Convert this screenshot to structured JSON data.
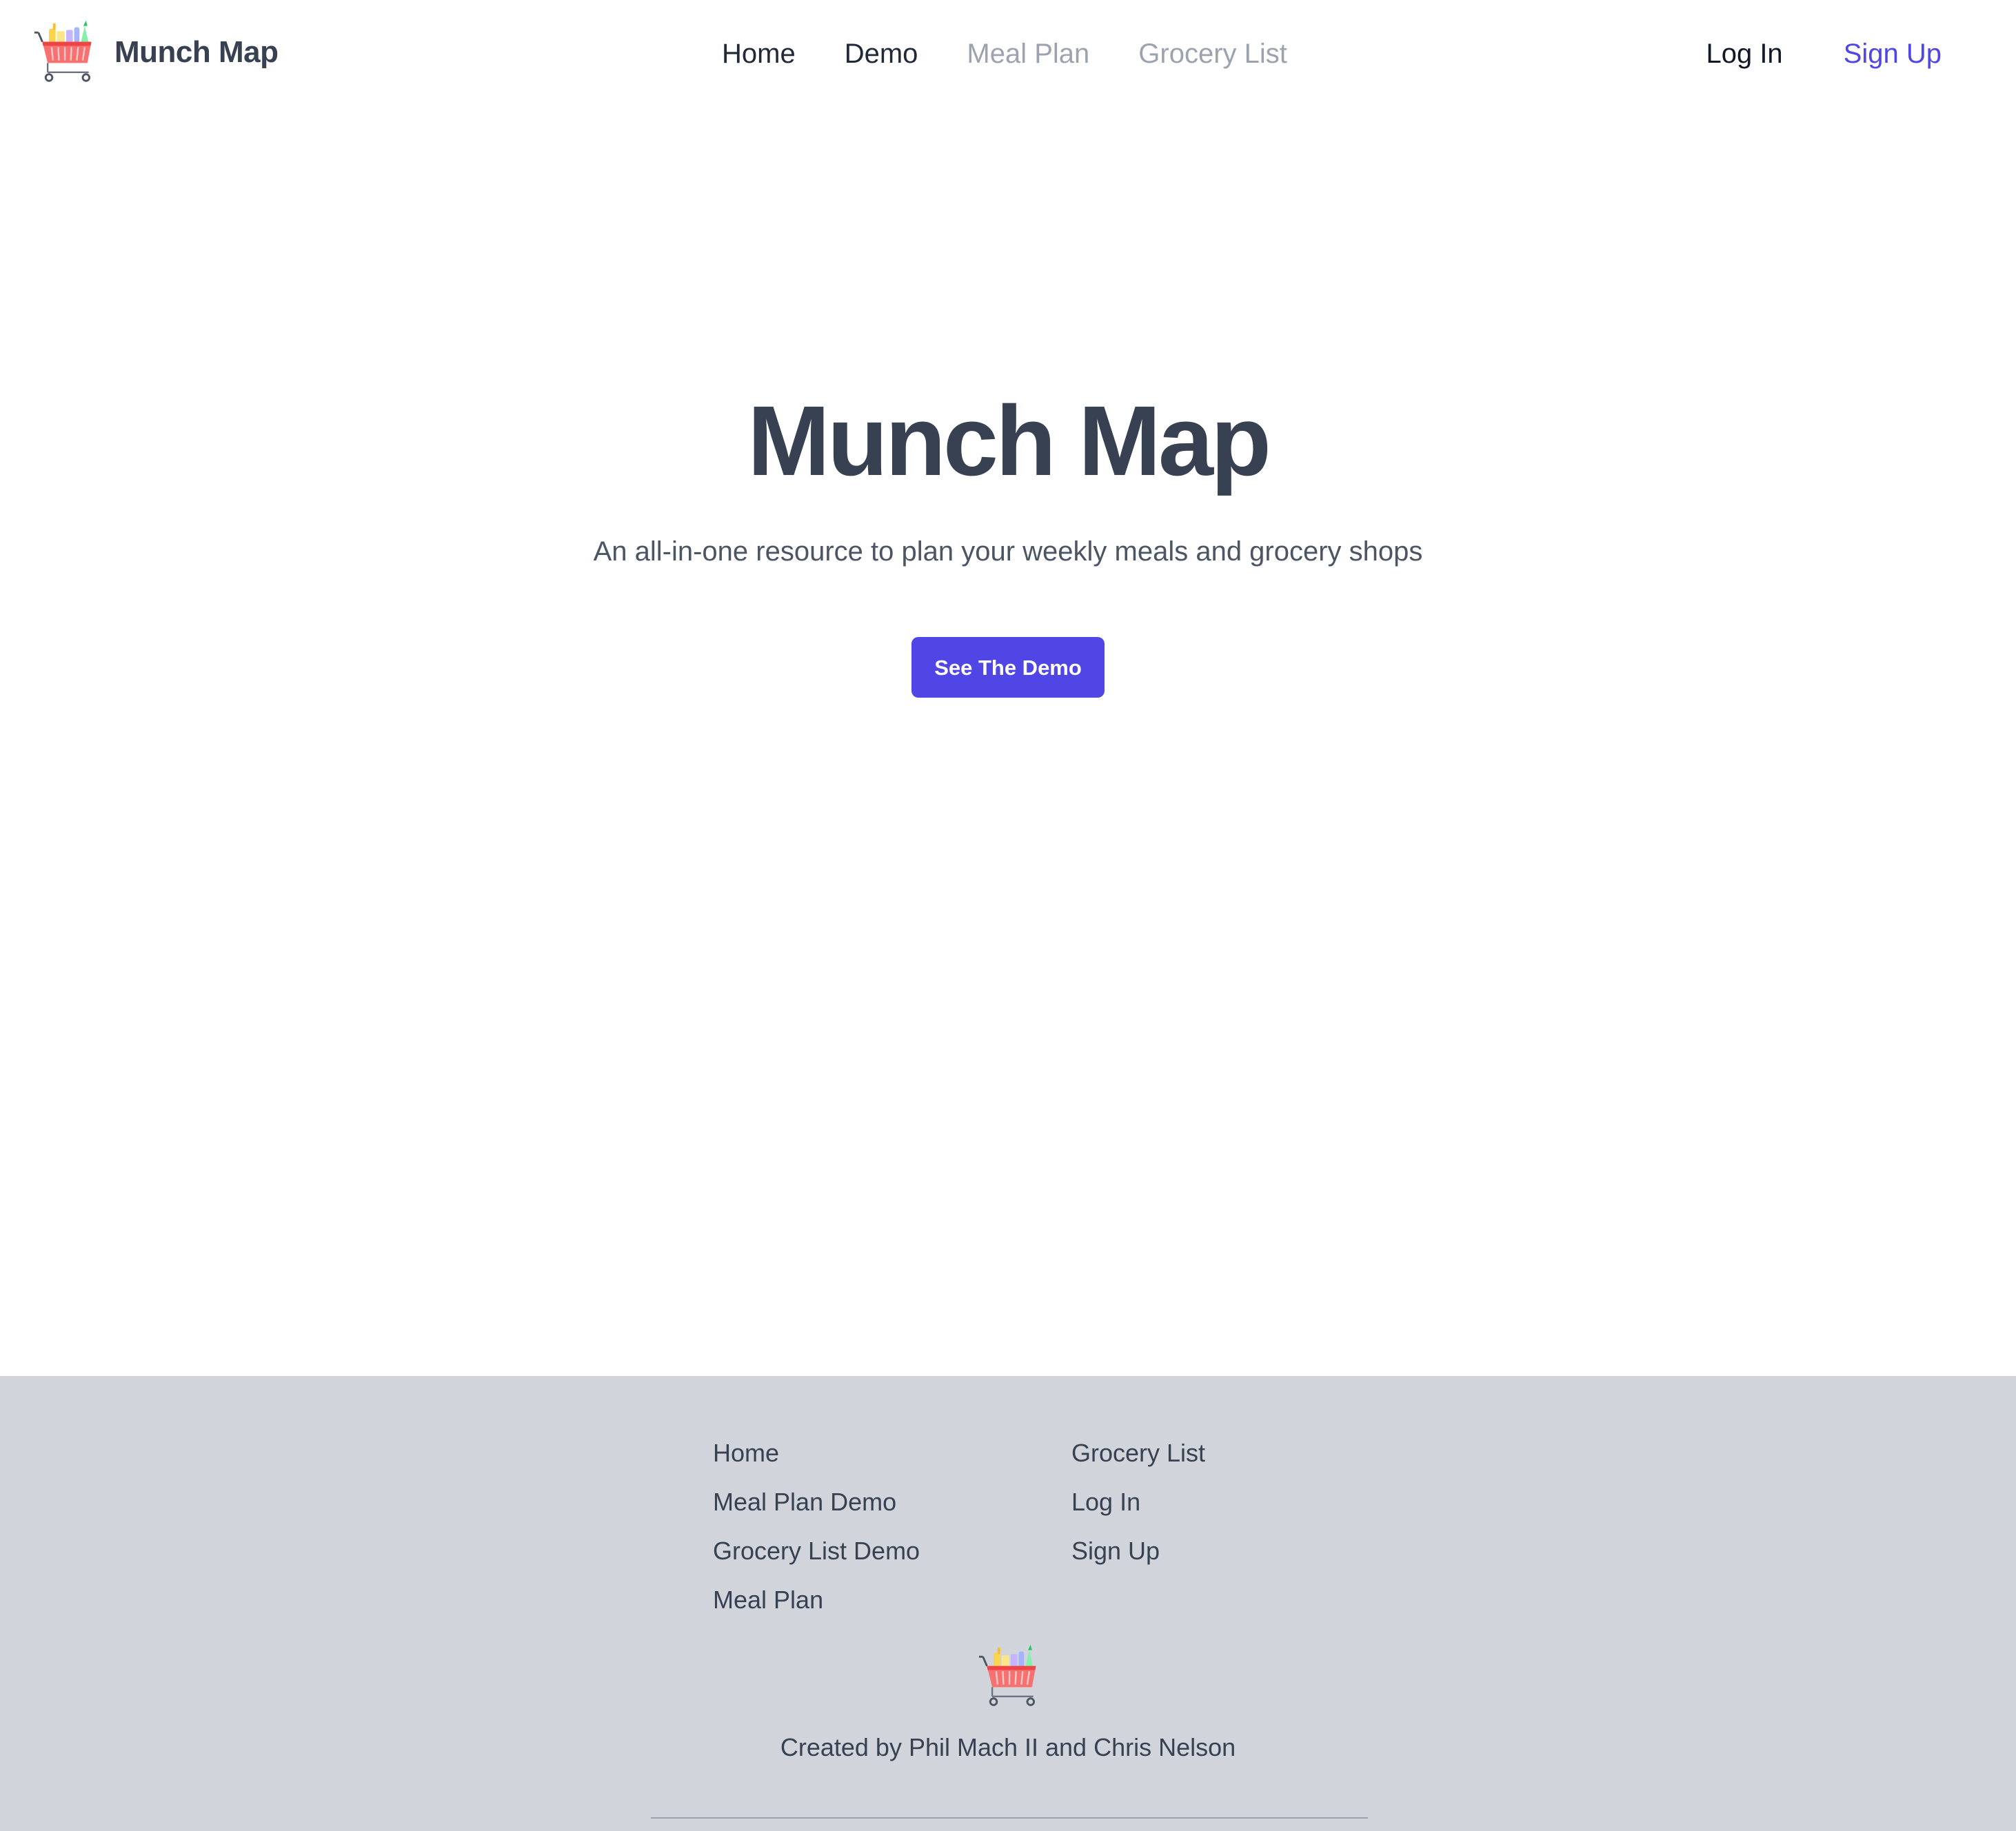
{
  "header": {
    "brand_name": "Munch Map",
    "logo_icon": "shopping-cart-icon",
    "nav": [
      {
        "label": "Home",
        "state": "active"
      },
      {
        "label": "Demo",
        "state": "active"
      },
      {
        "label": "Meal Plan",
        "state": "disabled"
      },
      {
        "label": "Grocery List",
        "state": "disabled"
      }
    ],
    "auth": {
      "login_label": "Log In",
      "signup_label": "Sign Up"
    }
  },
  "hero": {
    "title": "Munch Map",
    "subtitle": "An all-in-one resource to plan your weekly meals and grocery shops",
    "cta_label": "See The Demo"
  },
  "footer": {
    "links_col1": [
      "Home",
      "Meal Plan Demo",
      "Grocery List Demo",
      "Meal Plan"
    ],
    "links_col2": [
      "Grocery List",
      "Log In",
      "Sign Up"
    ],
    "logo_icon": "shopping-cart-icon",
    "credit": "Created by Phil Mach II and Chris Nelson"
  },
  "colors": {
    "accent": "#4f46e5",
    "text_dark": "#374151",
    "text_muted": "#9ca3af",
    "footer_bg": "#d1d5db",
    "cart_basket": "#f87171"
  }
}
